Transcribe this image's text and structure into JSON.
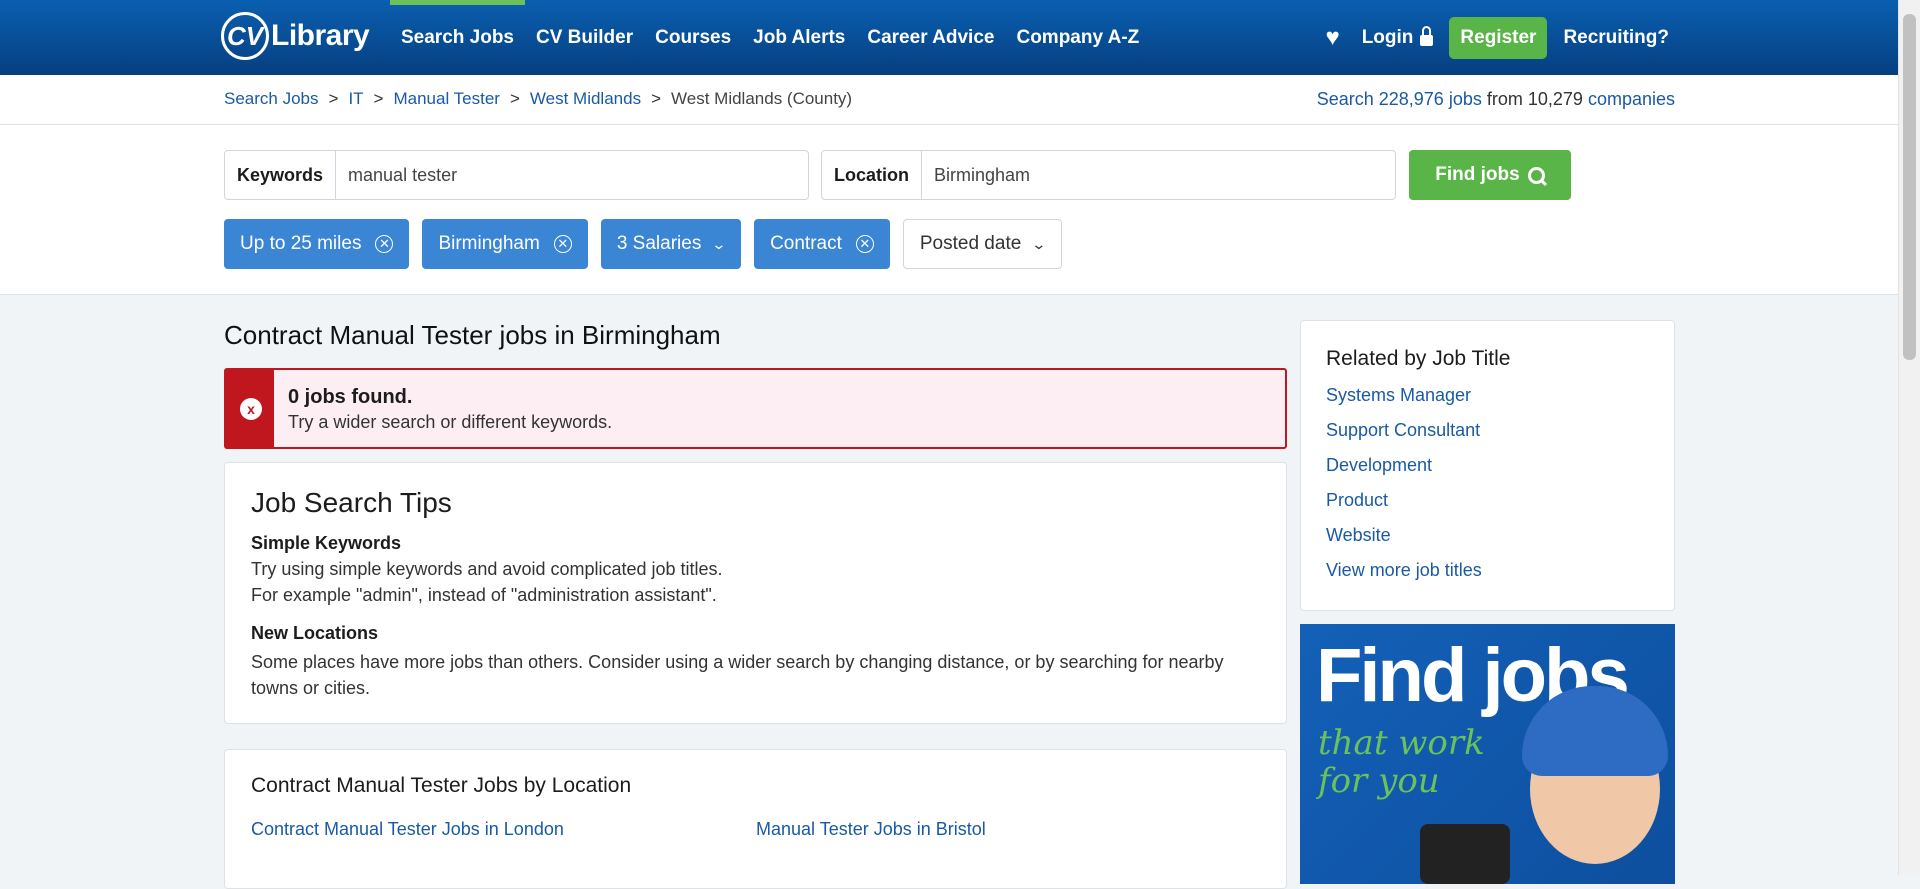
{
  "nav": {
    "logo_cv": "CV",
    "logo_text": "Library",
    "items": [
      "Search Jobs",
      "CV Builder",
      "Courses",
      "Job Alerts",
      "Career Advice",
      "Company A-Z"
    ],
    "login": "Login",
    "register": "Register",
    "recruiting": "Recruiting?"
  },
  "breadcrumb": {
    "items": [
      "Search Jobs",
      "IT",
      "Manual Tester",
      "West Midlands"
    ],
    "current": "West Midlands (County)"
  },
  "stats": {
    "prefix": "Search",
    "jobs": "228,976 jobs",
    "middle": "from",
    "companies_count": "10,279",
    "companies": "companies"
  },
  "search": {
    "keywords_label": "Keywords",
    "keywords_value": "manual tester",
    "location_label": "Location",
    "location_value": "Birmingham",
    "find_button": "Find jobs"
  },
  "filters": {
    "distance": "Up to 25 miles",
    "location": "Birmingham",
    "salaries": "3 Salaries",
    "type": "Contract",
    "posted": "Posted date"
  },
  "results": {
    "title": "Contract Manual Tester jobs in Birmingham",
    "alert_title": "0 jobs found.",
    "alert_text": "Try a wider search or different keywords."
  },
  "tips": {
    "heading": "Job Search Tips",
    "simple_title": "Simple Keywords",
    "simple_line1": "Try using simple keywords and avoid complicated job titles.",
    "simple_line2": "For example \"admin\", instead of \"administration assistant\".",
    "new_title": "New Locations",
    "new_text": "Some places have more jobs than others. Consider using a wider search by changing distance, or by searching for nearby towns or cities."
  },
  "by_location": {
    "heading": "Contract Manual Tester Jobs by Location",
    "links": [
      "Contract Manual Tester Jobs in London",
      "Manual Tester Jobs in Bristol"
    ]
  },
  "related": {
    "heading": "Related by Job Title",
    "links": [
      "Systems Manager",
      "Support Consultant",
      "Development",
      "Product",
      "Website",
      "View more job titles"
    ]
  },
  "ad": {
    "headline": "Find jobs",
    "tagline_1": "that work",
    "tagline_2": "for you"
  },
  "colors": {
    "nav_bg": "#0a5fb0",
    "accent_green": "#5ab548",
    "chip_blue": "#3a85d4",
    "link_blue": "#1a5aa4",
    "alert_red": "#c0161d"
  }
}
